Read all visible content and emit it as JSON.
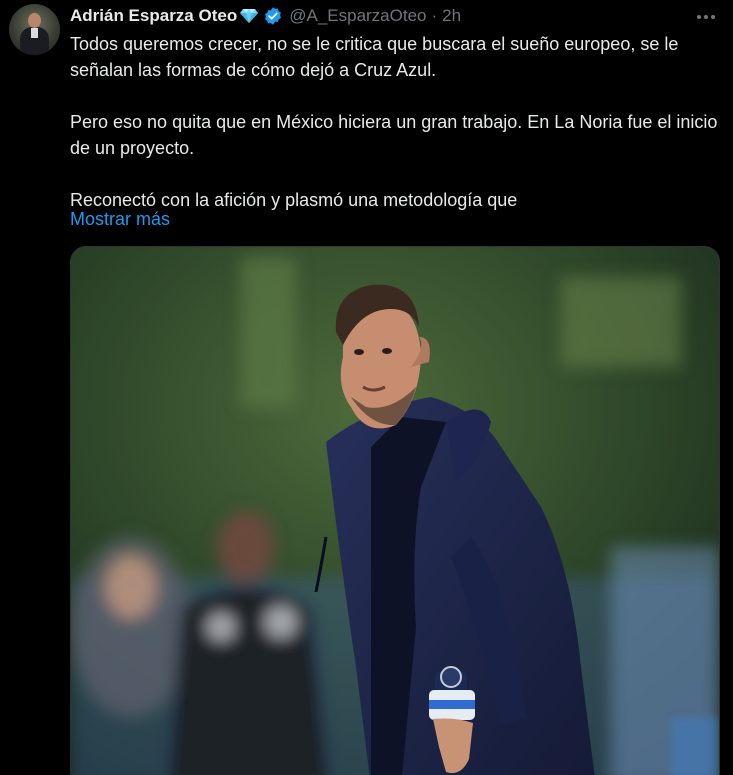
{
  "author": {
    "display_name": "Adrián Esparza Oteo",
    "handle": "@A_EsparzaOteo",
    "time_ago": "2h",
    "badges": [
      "diamond-icon",
      "verified-badge-icon"
    ]
  },
  "tweet": {
    "paragraphs": [
      "Todos queremos crecer, no se le critica que buscara el sueño europeo, se le señalan las formas de cómo dejó a Cruz Azul.",
      "Pero eso no quita que en México hiciera un gran trabajo. En La Noria fue el inicio de un proyecto.",
      "Reconectó con la afición y plasmó una metodología que"
    ],
    "show_more_label": "Mostrar más"
  },
  "icons": {
    "more": "more-options-icon",
    "verified": "verified-badge-icon",
    "gem": "diamond-icon"
  },
  "colors": {
    "background": "#000000",
    "text": "#e7e9ea",
    "muted": "#71767b",
    "link": "#1d9bf0",
    "verified": "#1d9bf0",
    "border": "#2f3336"
  }
}
